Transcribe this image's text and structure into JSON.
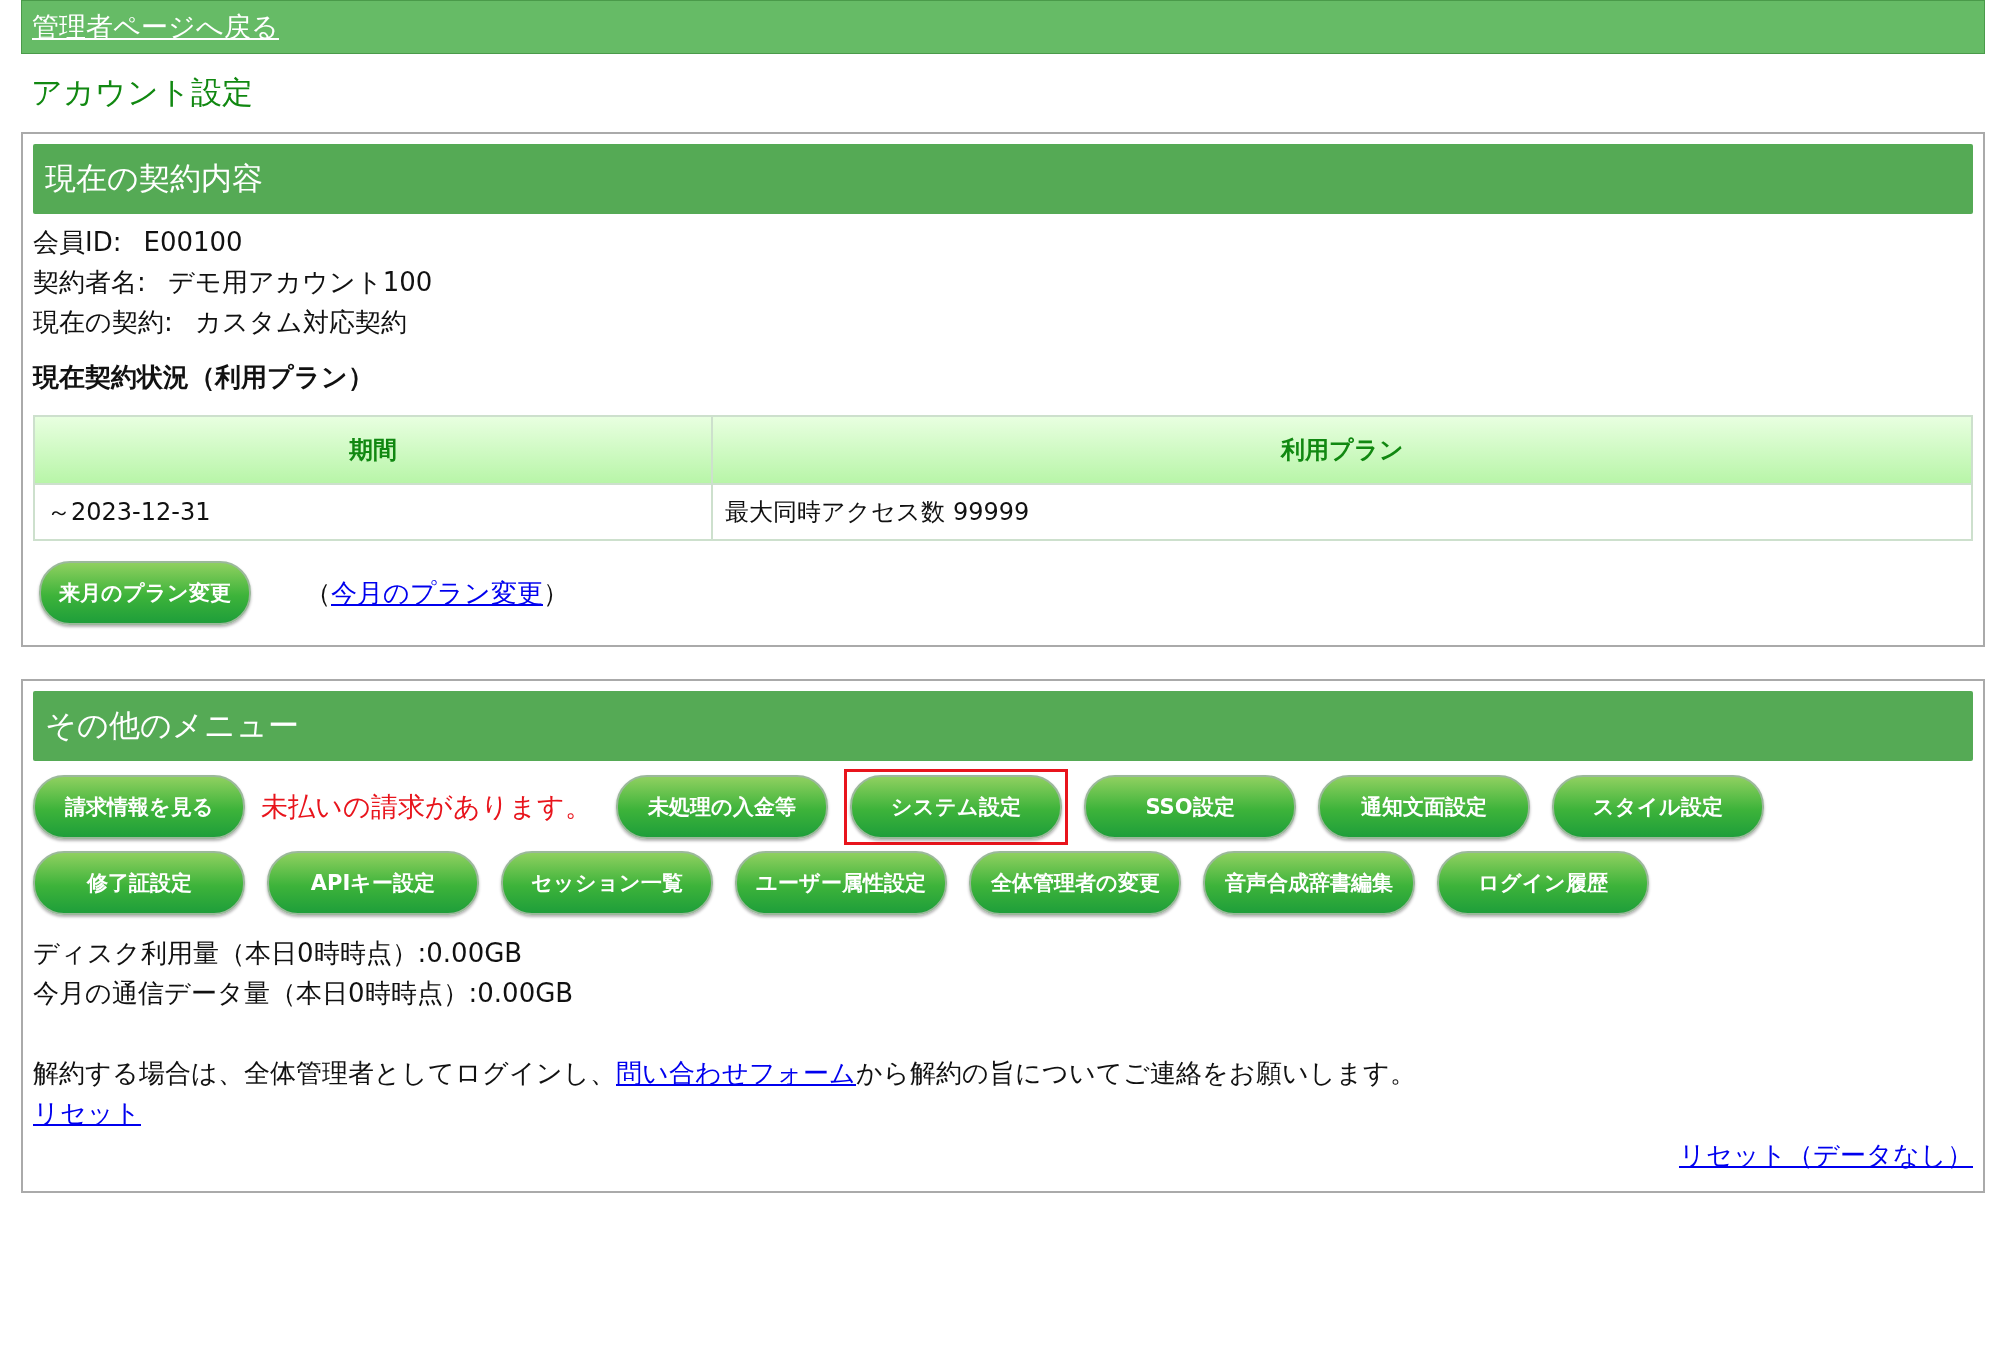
{
  "top_bar": {
    "link": "管理者ページへ戻る"
  },
  "page_title": "アカウント設定",
  "contract_panel": {
    "title": "現在の契約内容",
    "info": [
      {
        "label": "会員ID:",
        "value": "E00100"
      },
      {
        "label": "契約者名:",
        "value": "デモ用アカウント100"
      },
      {
        "label": "現在の契約:",
        "value": "カスタム対応契約"
      }
    ],
    "status_heading": "現在契約状況（利用プラン）",
    "table": {
      "columns": [
        "期間",
        "利用プラン"
      ],
      "rows": [
        [
          "～2023-12-31",
          "最大同時アクセス数 99999"
        ]
      ]
    },
    "button": "来月のプラン変更",
    "note": {
      "before": "（",
      "link": "今月のプラン変更",
      "after": "）"
    }
  },
  "menu_panel": {
    "title": "その他のメニュー",
    "items": [
      {
        "kind": "button",
        "label": "請求情報を見る",
        "highlighted": false
      },
      {
        "kind": "notice",
        "label": "未払いの請求があります。"
      },
      {
        "kind": "button",
        "label": "未処理の入金等",
        "highlighted": false
      },
      {
        "kind": "button",
        "label": "システム設定",
        "highlighted": true
      },
      {
        "kind": "button",
        "label": "SSO設定",
        "highlighted": false
      },
      {
        "kind": "button",
        "label": "通知文面設定",
        "highlighted": false
      },
      {
        "kind": "button",
        "label": "スタイル設定",
        "highlighted": false
      },
      {
        "kind": "break"
      },
      {
        "kind": "button",
        "label": "修了証設定",
        "highlighted": false
      },
      {
        "kind": "button",
        "label": "APIキー設定",
        "highlighted": false
      },
      {
        "kind": "button",
        "label": "セッション一覧",
        "highlighted": false
      },
      {
        "kind": "button",
        "label": "ユーザー属性設定",
        "highlighted": false
      },
      {
        "kind": "button",
        "label": "全体管理者の変更",
        "highlighted": false
      },
      {
        "kind": "button",
        "label": "音声合成辞書編集",
        "highlighted": false
      },
      {
        "kind": "button",
        "label": "ログイン履歴",
        "highlighted": false
      }
    ],
    "usage": [
      "ディスク利用量（本日0時時点）:0.00GB",
      "今月の通信データ量（本日0時時点）:0.00GB"
    ],
    "cancel_note": {
      "before": "解約する場合は、全体管理者としてログインし、",
      "link": "問い合わせフォーム",
      "after": "から解約の旨についてご連絡をお願いします。"
    },
    "reset_link": "リセット",
    "reset_no_data_link": "リセット（データなし）"
  }
}
